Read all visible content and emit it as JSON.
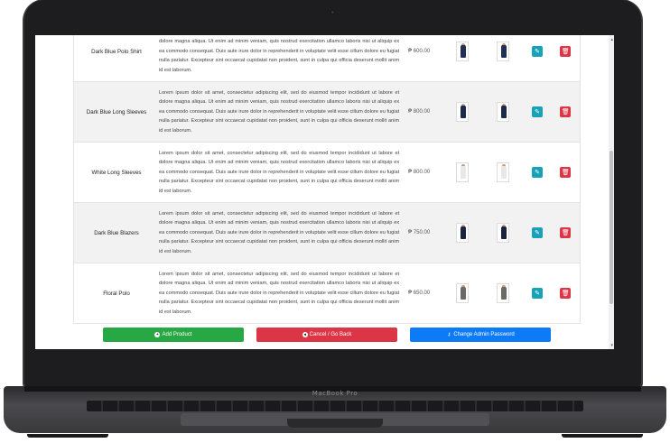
{
  "device": {
    "label": "MacBook Pro"
  },
  "colors": {
    "add": "#28a745",
    "cancel": "#dc3545",
    "password": "#0d7bf5",
    "edit": "#17a2b8",
    "delete": "#dc3545"
  },
  "products": [
    {
      "name": "Dark Blue Polo Shirt",
      "description": "Lorem ipsum dolor sit amet, consectetur adipiscing elit, sed do eiusmod tempor incididunt ut labore et dolore magna aliqua. Ut enim ad minim veniam, quis nostrud exercitation ullamco laboris nisi ut aliquip ex ea commodo consequat. Duis aute irure dolor in reprehenderit in voluptate velit esse cillum dolore eu fugiat nulla pariatur. Excepteur sint occaecat cupidatat non proident, sunt in culpa qui officia deserunt mollit anim id est laborum.",
      "price": "₱ 600.00",
      "color": "#1f2f55"
    },
    {
      "name": "Dark Blue Long Sleeves",
      "description": "Lorem ipsum dolor sit amet, consectetur adipiscing elit, sed do eiusmod tempor incididunt ut labore et dolore magna aliqua. Ut enim ad minim veniam, quis nostrud exercitation ullamco laboris nisi ut aliquip ex ea commodo consequat. Duis aute irure dolor in reprehenderit in voluptate velit esse cillum dolore eu fugiat nulla pariatur. Excepteur sint occaecat cupidatat non proident, sunt in culpa qui officia deserunt mollit anim id est laborum.",
      "price": "₱ 800.00",
      "color": "#1c2a4d"
    },
    {
      "name": "White Long Sleeves",
      "description": "Lorem ipsum dolor sit amet, consectetur adipiscing elit, sed do eiusmod tempor incididunt ut labore et dolore magna aliqua. Ut enim ad minim veniam, quis nostrud exercitation ullamco laboris nisi ut aliquip ex ea commodo consequat. Duis aute irure dolor in reprehenderit in voluptate velit esse cillum dolore eu fugiat nulla pariatur. Excepteur sint occaecat cupidatat non proident, sunt in culpa qui officia deserunt mollit anim id est laborum.",
      "price": "₱ 800.00",
      "color": "#e8e8e8"
    },
    {
      "name": "Dark Blue Blazers",
      "description": "Lorem ipsum dolor sit amet, consectetur adipiscing elit, sed do eiusmod tempor incididunt ut labore et dolore magna aliqua. Ut enim ad minim veniam, quis nostrud exercitation ullamco laboris nisi ut aliquip ex ea commodo consequat. Duis aute irure dolor in reprehenderit in voluptate velit esse cillum dolore eu fugiat nulla pariatur. Excepteur sint occaecat cupidatat non proident, sunt in culpa qui officia deserunt mollit anim id est laborum.",
      "price": "₱ 750.00",
      "color": "#1a2340"
    },
    {
      "name": "Floral Polo",
      "description": "Lorem ipsum dolor sit amet, consectetur adipiscing elit, sed do eiusmod tempor incididunt ut labore et dolore magna aliqua. Ut enim ad minim veniam, quis nostrud exercitation ullamco laboris nisi ut aliquip ex ea commodo consequat. Duis aute irure dolor in reprehenderit in voluptate velit esse cillum dolore eu fugiat nulla pariatur. Excepteur sint occaecat cupidatat non proident, sunt in culpa qui officia deserunt mollit anim id est laborum.",
      "price": "₱ 650.00",
      "color": "#6d6a66"
    }
  ],
  "row_actions": {
    "edit_icon": "pencil-square-icon",
    "delete_icon": "trash-icon",
    "edit_glyph": "✎",
    "delete_glyph": "🗑"
  },
  "actions": {
    "add_label": "Add Product",
    "cancel_label": "Cancel / Go Back",
    "password_label": "Change Admin Password"
  }
}
